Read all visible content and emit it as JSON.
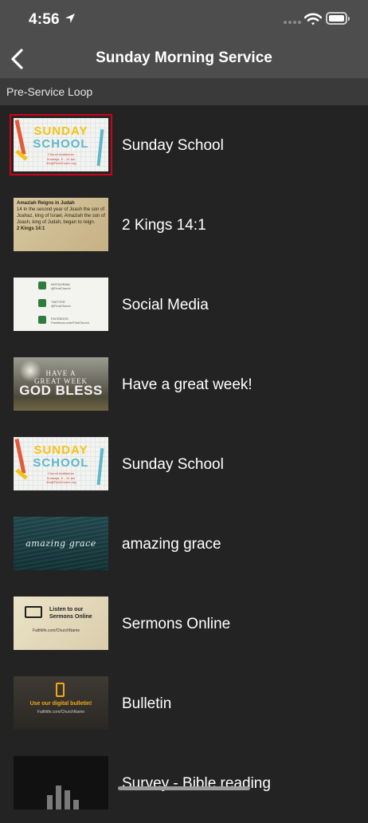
{
  "status_bar": {
    "time": "4:56",
    "battery_icon": "battery-icon",
    "wifi_icon": "wifi-icon"
  },
  "nav": {
    "title": "Sunday Morning Service",
    "back_icon": "chevron-left-icon"
  },
  "section": {
    "label": "Pre-Service Loop"
  },
  "slides": [
    {
      "label": "Sunday School",
      "selected": true,
      "thumb": {
        "line1": "SUNDAY",
        "line2": "SCHOOL",
        "line3": "Church Auditorium",
        "line4": "Sundays, 9 – 11 am",
        "line5": "Jim@FirstChurch.org"
      }
    },
    {
      "label": "2 Kings 14:1",
      "selected": false,
      "thumb": {
        "heading": "Amaziah Reigns in Judah",
        "body": "14 In the second year of Joash the son of Joahaz, king of Israel, Amaziah the son of Joash, king of Judah, began to reign.",
        "ref": "2 Kings 14:1"
      }
    },
    {
      "label": "Social Media",
      "selected": false,
      "thumb": {
        "instagram": "INSTAGRAM",
        "instagram_handle": "@FirstChurch",
        "twitter": "TWITTER",
        "twitter_handle": "@FirstChurch",
        "facebook": "FACEBOOK",
        "facebook_handle": "Facebook.com/FirstChurch"
      }
    },
    {
      "label": "Have a great week!",
      "selected": false,
      "thumb": {
        "line1": "HAVE A",
        "line2": "GREAT WEEK",
        "line3": "GOD BLESS"
      }
    },
    {
      "label": "Sunday School",
      "selected": false,
      "thumb": {
        "line1": "SUNDAY",
        "line2": "SCHOOL",
        "line3": "Church Auditorium",
        "line4": "Sundays, 9 – 11 am",
        "line5": "Jim@FirstChurch.org"
      }
    },
    {
      "label": "amazing grace",
      "selected": false,
      "thumb": {
        "line1": "amazing grace"
      }
    },
    {
      "label": "Sermons Online",
      "selected": false,
      "thumb": {
        "line1": "Listen to our",
        "line2": "Sermons Online",
        "url": "Faithlife.com/ChurchName"
      }
    },
    {
      "label": "Bulletin",
      "selected": false,
      "thumb": {
        "line1": "Use our digital bulletin!",
        "url": "Faithlife.com/ChurchName"
      }
    },
    {
      "label": "Survey - Bible reading",
      "selected": false,
      "thumb": {}
    }
  ]
}
